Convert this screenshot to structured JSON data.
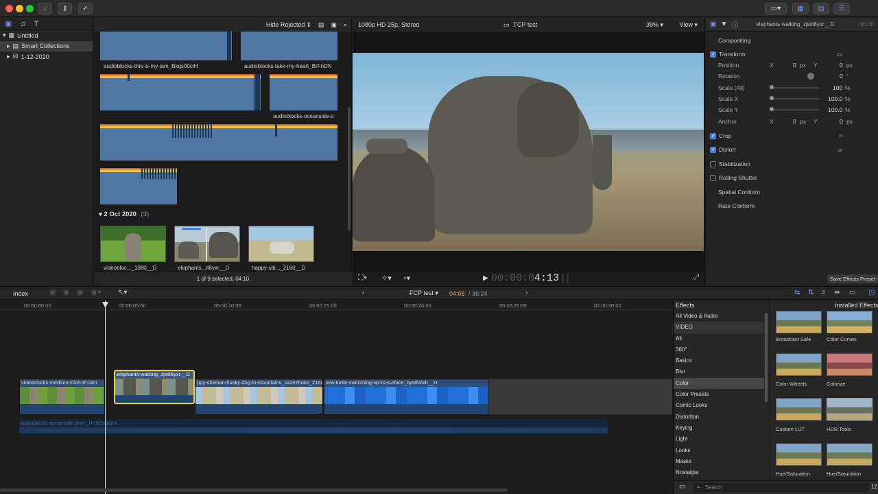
{
  "toolbar": {
    "import_icon": "download-arrow",
    "keywords_icon": "key",
    "check_icon": "checkmark-circle"
  },
  "library": {
    "items": [
      {
        "label": "Untitled",
        "icon": "library-grid"
      },
      {
        "label": "Smart Collections",
        "icon": "folder-grid"
      },
      {
        "label": "1-12-2020",
        "icon": "event-star"
      }
    ]
  },
  "browser": {
    "filter_label": "Hide Rejected",
    "clips": [
      "audioblocks-this-is-my-jam_Bkqs00ciH",
      "audioblocks-take-my-heart_BrFnDN",
      "audioblocks-oceanside-d"
    ],
    "date_group": {
      "label": "2 Oct 2020",
      "count": "(3)"
    },
    "thumbs": [
      "videobloc..._1080__D",
      "elephants...it8yxr__D",
      "happy-sib..._2160__D"
    ],
    "status": "1 of 9 selected, 04:10"
  },
  "viewer": {
    "format": "1080p HD 25p, Stereo",
    "project": "FCP test",
    "zoom": "39%",
    "view_label": "View",
    "timecode_dim": "00:00:0",
    "timecode_bright": "4:13"
  },
  "inspector": {
    "clip_name": "elephants-walking_zjwit8yxr__D",
    "clip_time": "00:00",
    "rows": {
      "compositing": "Compositing",
      "transform": "Transform",
      "position": "Position",
      "rotation": "Rotation",
      "scale_all": "Scale (All)",
      "scale_x": "Scale X",
      "scale_y": "Scale Y",
      "anchor": "Anchor",
      "crop": "Crop",
      "distort": "Distort",
      "stabilization": "Stabilization",
      "rolling_shutter": "Rolling Shutter",
      "spatial_conform": "Spatial Conform",
      "rate_conform": "Rate Conform"
    },
    "values": {
      "x": "X",
      "y": "Y",
      "px": "px",
      "zero": "0",
      "deg": "°",
      "scale_all": "100",
      "scale_x": "100.0",
      "scale_y": "100.0",
      "pct": "%"
    },
    "save_preset": "Save Effects Preset"
  },
  "timeline_bar": {
    "index": "Index",
    "project": "FCP test",
    "position": "04:08",
    "duration": "/ 36:24"
  },
  "timeline": {
    "ruler": [
      "00:00:00:00",
      "00:00:05:00",
      "00:00:10:00",
      "00:00:15:00",
      "00:00:20:00",
      "00:00:25:00",
      "00:00:30:00"
    ],
    "clips": [
      "videoblocks-medium-shot-of-cat-i",
      "elephants-walking_zjwit8yxr__D",
      "ppy-siberian-husky-dog-in-mountains_saze7hoke_2160",
      "sea-turtle-swimming-up-to-surface_by5lfwixh__D"
    ],
    "audio_clip": "audioblocks-oceanside-drive_HY8OvaGm"
  },
  "effects": {
    "title": "Effects",
    "installed": "Installed Effects",
    "categories": [
      "All Video & Audio",
      "VIDEO",
      "All",
      "360°",
      "Basics",
      "Blur",
      "Color",
      "Color Presets",
      "Comic Looks",
      "Distortion",
      "Keying",
      "Light",
      "Looks",
      "Masks",
      "Nostalgia"
    ],
    "selected_category": "Color",
    "tiles": [
      "Broadcast Safe",
      "Color Curves",
      "Color Wheels",
      "Colorize",
      "Custom LUT",
      "HDR Tools",
      "Hue/Saturation",
      "Hue/Saturation"
    ],
    "search_placeholder": "Search",
    "count": "12"
  },
  "colors": {
    "accent": "#4a7fe0",
    "selected_clip": "#f1d040"
  }
}
